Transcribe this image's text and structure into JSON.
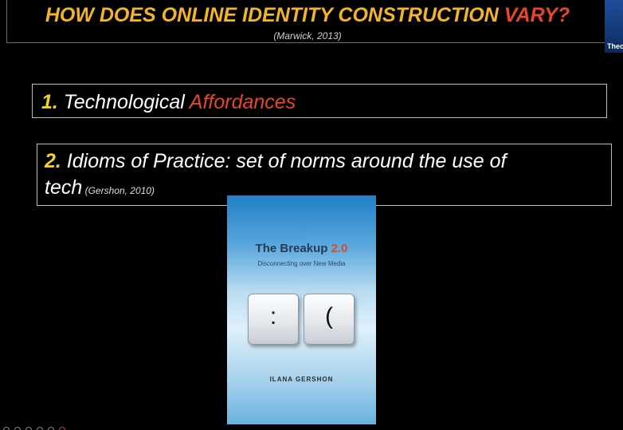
{
  "slide": {
    "title_main": "HOW DOES ONLINE IDENTITY CONSTRUCTION ",
    "title_accent": "VARY?",
    "citation": "(Marwick, 2013)",
    "point1": {
      "number": "1.",
      "text": " Technological ",
      "accent": "Affordances"
    },
    "point2": {
      "number": "2.",
      "text": " Idioms of Practice: set of norms around the use of",
      "line2": "tech",
      "cite": " (Gershon, 2010)"
    }
  },
  "book": {
    "title": "The Breakup ",
    "title_accent": "2.0",
    "subtitle": "Disconnecting over New Media",
    "key1": ":",
    "key2": "(",
    "author": "ILANA GERSHON"
  },
  "participant": {
    "name": "Theo"
  }
}
